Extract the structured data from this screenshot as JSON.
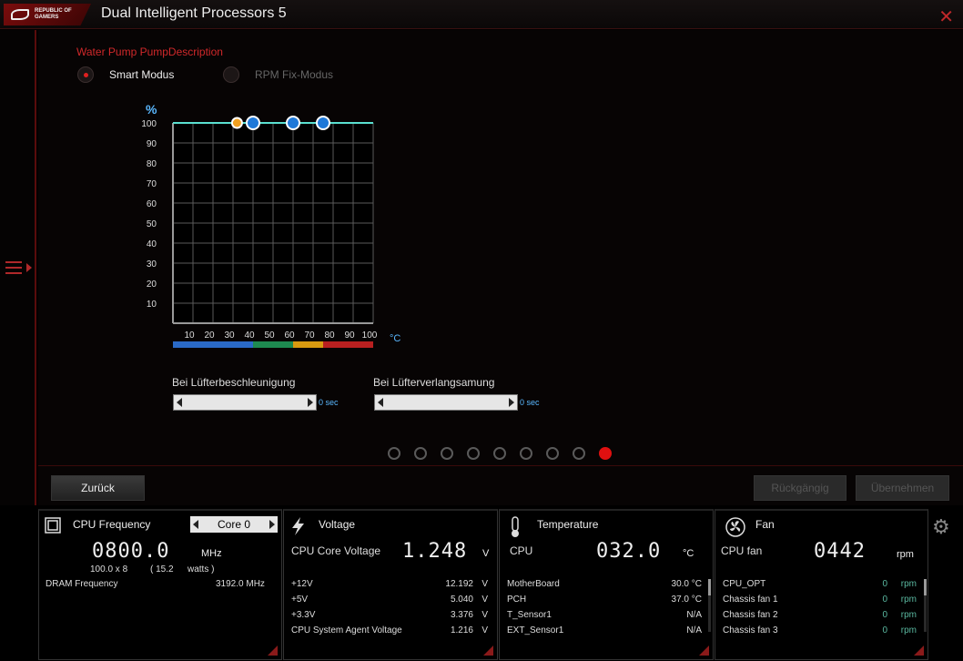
{
  "window": {
    "title": "Dual Intelligent Processors 5",
    "logo_text": "REPUBLIC OF GAMERS"
  },
  "pump": {
    "title": "Water Pump PumpDescription",
    "modes": [
      {
        "label": "Smart Modus",
        "selected": true
      },
      {
        "label": "RPM Fix-Modus",
        "selected": false
      }
    ]
  },
  "chart_data": {
    "type": "line",
    "title": "",
    "xlabel": "°C",
    "ylabel": "%",
    "xlim": [
      0,
      100
    ],
    "ylim": [
      0,
      100
    ],
    "x_ticks": [
      10,
      20,
      30,
      40,
      50,
      60,
      70,
      80,
      90,
      100
    ],
    "y_ticks": [
      10,
      20,
      30,
      40,
      50,
      60,
      70,
      80,
      90,
      100
    ],
    "series": [
      {
        "points": [
          [
            0,
            100
          ],
          [
            32,
            100
          ],
          [
            40,
            100
          ],
          [
            60,
            100
          ],
          [
            75,
            100
          ],
          [
            100,
            100
          ]
        ],
        "color": "#5ae0d0"
      }
    ],
    "control_points": [
      {
        "x": 32,
        "y": 100,
        "color": "#f0a020"
      },
      {
        "x": 40,
        "y": 100,
        "color": "#1e78d8"
      },
      {
        "x": 60,
        "y": 100,
        "color": "#1e78d8"
      },
      {
        "x": 75,
        "y": 100,
        "color": "#1e78d8"
      }
    ],
    "temp_bands": [
      {
        "from": 0,
        "to": 40,
        "color": "#2a6ac8"
      },
      {
        "from": 40,
        "to": 60,
        "color": "#1e8a50"
      },
      {
        "from": 60,
        "to": 75,
        "color": "#d89a10"
      },
      {
        "from": 75,
        "to": 100,
        "color": "#b82020"
      }
    ],
    "grid": true
  },
  "sliders": {
    "accel": {
      "label": "Bei Lüfterbeschleunigung",
      "value": "0 sec"
    },
    "decel": {
      "label": "Bei Lüfterverlangsamung",
      "value": "0 sec"
    }
  },
  "pager": {
    "count": 9,
    "active": 8
  },
  "buttons": {
    "back": "Zurück",
    "undo": "Rückgängig",
    "apply": "Übernehmen"
  },
  "cpu_freq": {
    "title": "CPU Frequency",
    "core": "Core 0",
    "value": "0800.0",
    "unit": "MHz",
    "multiplier": "100.0  x  8",
    "watts_value": "( 15.2",
    "watts_unit": "watts )",
    "dram_label": "DRAM Frequency",
    "dram_value": "3192.0  MHz"
  },
  "voltage": {
    "title": "Voltage",
    "main_label": "CPU Core Voltage",
    "main_value": "1.248",
    "main_unit": "V",
    "rows": [
      {
        "label": "+12V",
        "value": "12.192",
        "unit": "V"
      },
      {
        "label": "+5V",
        "value": "5.040",
        "unit": "V"
      },
      {
        "label": "+3.3V",
        "value": "3.376",
        "unit": "V"
      },
      {
        "label": "CPU System Agent Voltage",
        "value": "1.216",
        "unit": "V"
      }
    ]
  },
  "temperature": {
    "title": "Temperature",
    "main_label": "CPU",
    "main_value": "032.0",
    "main_unit": "°C",
    "rows": [
      {
        "label": "MotherBoard",
        "value": "30.0 °C"
      },
      {
        "label": "PCH",
        "value": "37.0 °C"
      },
      {
        "label": "T_Sensor1",
        "value": "N/A"
      },
      {
        "label": "EXT_Sensor1",
        "value": "N/A"
      }
    ]
  },
  "fan": {
    "title": "Fan",
    "main_label": "CPU fan",
    "main_value": "0442",
    "main_unit": "rpm",
    "rows": [
      {
        "label": "CPU_OPT",
        "value": "0",
        "unit": "rpm"
      },
      {
        "label": "Chassis fan 1",
        "value": "0",
        "unit": "rpm"
      },
      {
        "label": "Chassis fan 2",
        "value": "0",
        "unit": "rpm"
      },
      {
        "label": "Chassis fan 3",
        "value": "0",
        "unit": "rpm"
      }
    ]
  }
}
